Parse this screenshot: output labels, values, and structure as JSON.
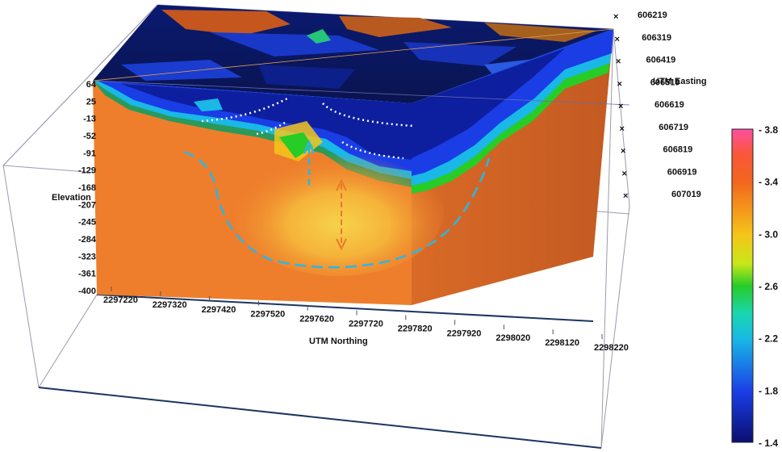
{
  "chart_data": {
    "type": "heatmap",
    "title": "",
    "elevation": {
      "label": "Elevation",
      "ticks": [
        "64",
        "25",
        "-13",
        "-52",
        "-91",
        "-129",
        "-168",
        "-207",
        "-245",
        "-284",
        "-323",
        "-361",
        "-400"
      ],
      "range": [
        -400,
        64
      ]
    },
    "northing": {
      "label": "UTM Northing",
      "ticks": [
        "2297220",
        "2297320",
        "2297420",
        "2297520",
        "2297620",
        "2297720",
        "2297820",
        "2297920",
        "2298020",
        "2298120",
        "2298220"
      ],
      "range": [
        2297220,
        2298220
      ]
    },
    "easting": {
      "label": "UTM Easting",
      "ticks": [
        "606219",
        "606319",
        "606419",
        "606519",
        "606619",
        "606719",
        "606819",
        "606919",
        "607019"
      ],
      "range": [
        606219,
        607019
      ]
    },
    "colorbar": {
      "labels": [
        "- 3.8",
        "- 3.4",
        "- 3.0",
        "- 2.6",
        "- 2.2",
        "- 1.8",
        "- 1.4"
      ],
      "values": [
        3.8,
        3.4,
        3.0,
        2.6,
        2.2,
        1.8,
        1.4
      ],
      "range": [
        1.4,
        3.8
      ],
      "colors": [
        "#ff4fa0",
        "#f2661e",
        "#f5c61a",
        "#27cc27",
        "#19b8e6",
        "#1a3de6",
        "#0b0f6e"
      ]
    },
    "model_colors": {
      "body": "#e87a2a",
      "front_face": "#ee7e2c",
      "side_face": "#cf6425",
      "top_face": "#0a1660",
      "anomaly": "#f7c23c"
    },
    "annotations": {
      "dashed_outline_color": "#2bb6e8",
      "arrow_up_color": "#2bb6e8",
      "arrow_double_color": "#e87a2a",
      "dotted_lines_color": "#ffffff"
    }
  }
}
